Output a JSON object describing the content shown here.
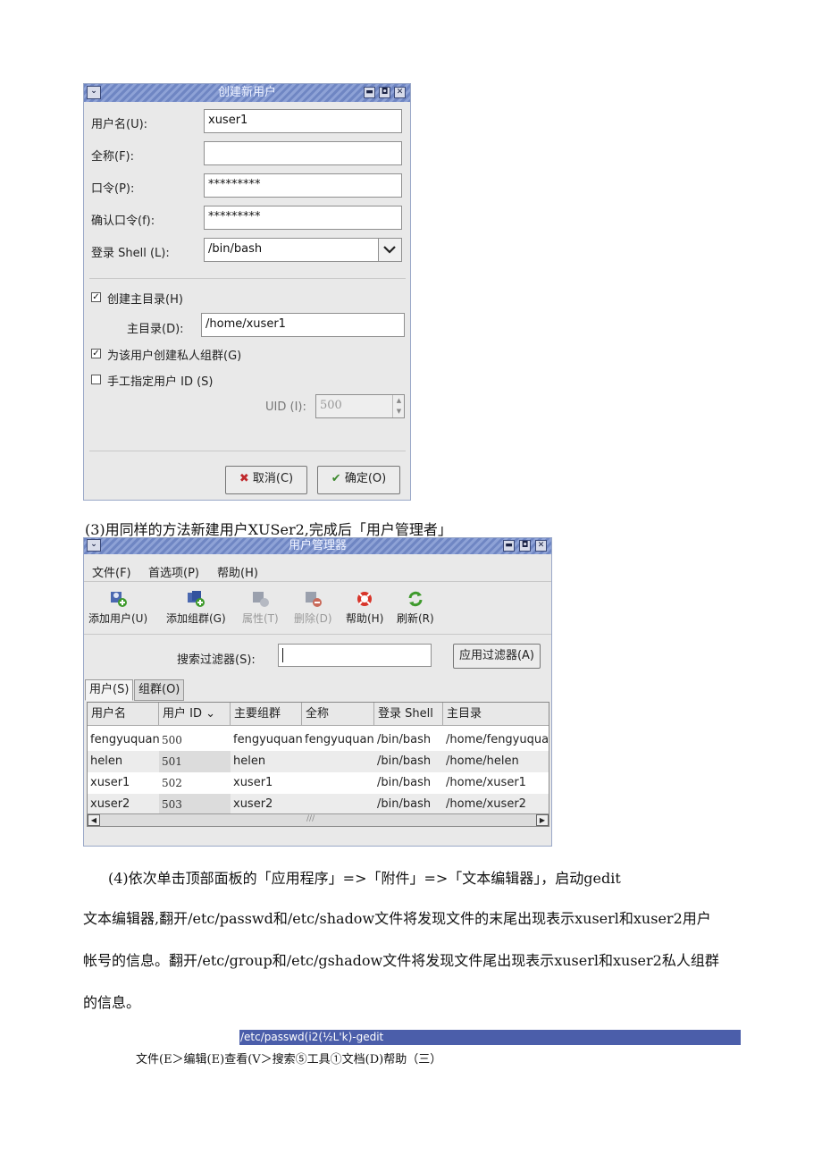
{
  "dialog1": {
    "title": "创建新用户",
    "controls": {
      "minimize": "▬",
      "maximize": "◘",
      "close": "✕",
      "menu": "⌄"
    },
    "username_label": "用户名(U):",
    "username_value": "xuser1",
    "fullname_label": "全称(F):",
    "fullname_value": "",
    "password_label": "口令(P):",
    "password_value": "*********",
    "confirm_label": "确认口令(f):",
    "confirm_value": "*********",
    "shell_label": "登录 Shell (L):",
    "shell_value": "/bin/bash",
    "create_home_label": "创建主目录(H)",
    "create_home_checked": true,
    "home_label": "主目录(D):",
    "home_value": "/home/xuser1",
    "private_group_label": "为该用户创建私人组群(G)",
    "private_group_checked": true,
    "manual_uid_label": "手工指定用户 ID (S)",
    "manual_uid_checked": false,
    "uid_label": "UID (I):",
    "uid_value": "500",
    "cancel_label": "取消(C)",
    "ok_label": "确定(O)"
  },
  "caption1": "(3)用同样的方法新建用户XUSer2,完成后「用户管理者」",
  "dialog2": {
    "title": "用户管理器",
    "menu": [
      "文件(F)",
      "首选项(P)",
      "帮助(H)"
    ],
    "toolbar": [
      "添加用户(U)",
      "添加组群(G)",
      "属性(T)",
      "删除(D)",
      "帮助(H)",
      "刷新(R)"
    ],
    "filter_label": "搜索过滤器(S):",
    "filter_value": "",
    "apply_filter_label": "应用过滤器(A)",
    "tabs": [
      "用户(S)",
      "组群(O)"
    ],
    "columns": [
      "用户名",
      "用户 ID ⌄",
      "主要组群",
      "全称",
      "登录 Shell",
      "主目录"
    ],
    "rows": [
      [
        "fengyuquan",
        "500",
        "fengyuquan",
        "fengyuquan",
        "/bin/bash",
        "/home/fengyuquan"
      ],
      [
        "helen",
        "501",
        "helen",
        "",
        "/bin/bash",
        "/home/helen"
      ],
      [
        "xuser1",
        "502",
        "xuser1",
        "",
        "/bin/bash",
        "/home/xuser1"
      ],
      [
        "xuser2",
        "503",
        "xuser2",
        "",
        "/bin/bash",
        "/home/xuser2"
      ]
    ]
  },
  "paragraph": {
    "line1": "(4)依次单击顶部面板的「应用程序」=>「附件」=>「文本编辑器」，启动gedit",
    "line2": "文本编辑器,翻开/etc/passwd和/etc/shadow文件将发现文件的末尾出现表示xuserl和xuser2用户",
    "line3": "帐号的信息。翻开/etc/group和/etc/gshadow文件将发现文件尾出现表示xuserl和xuser2私人组群",
    "line4": "的信息。"
  },
  "gedit": {
    "title": "/etc/passwd(i2(½L'k)-gedit",
    "menu": "文件(E＞编辑(E)查看(V＞搜索⑤工具①文档(D)帮助（三）"
  },
  "colors": {
    "titlebar": "#7a90cb",
    "gedit_bar": "#4b5eaa",
    "row_alt": "#ececec"
  }
}
